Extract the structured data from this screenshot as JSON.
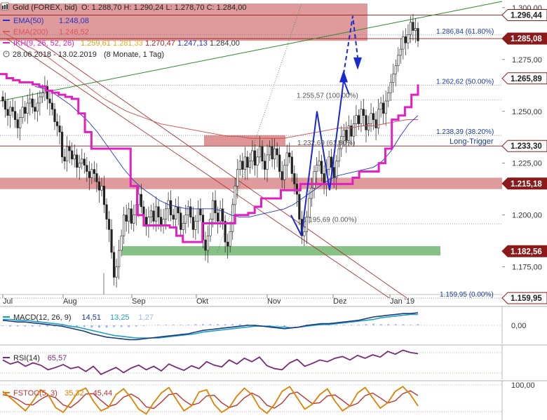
{
  "header": {
    "instrument": "Gold (FOREX, bid)",
    "ohlc": "O: 1.288,70  H: 1.290,24  L: 1.278,70  C: 1.284,00",
    "legend": [
      {
        "label": "EMA(50)",
        "value": "1.248,08",
        "color": "#2233cc"
      },
      {
        "label": "EMA(200)",
        "value": "1.246,52",
        "color": "#dd5555"
      },
      {
        "label": "IKH(9, 26, 52, 26)",
        "value": "",
        "color": "#e020c0"
      }
    ],
    "ikh_values": [
      {
        "v": "1.259,61",
        "color": "#d4a017"
      },
      {
        "v": "1.281,33",
        "color": "#e0b020"
      },
      {
        "v": "1.270,47",
        "color": "#aa2222"
      },
      {
        "v": "1.247,13",
        "color": "#2233cc"
      },
      {
        "v": "1.284,00",
        "color": "#333333"
      }
    ],
    "period": "28.06.2018 - 13.02.2019",
    "period_note": "(8 Monate, 1 Tag)"
  },
  "chart_data": [
    {
      "type": "candlestick",
      "ylim": [
        1160,
        1302
      ],
      "y_ticks": [
        "1.300,00",
        "1.275,00",
        "1.250,00",
        "1.225,00",
        "1.200,00",
        "1.175,00"
      ],
      "y_tick_values": [
        1300,
        1275,
        1250,
        1225,
        1200,
        1175
      ],
      "x_ticks": [
        "Jul",
        "Aug",
        "Sep",
        "Okt",
        "Nov",
        "Dez",
        "Jan '19"
      ],
      "price_tags": [
        {
          "label": "1.296,44",
          "value": 1296.44,
          "style": "line"
        },
        {
          "label": "1.285,08",
          "value": 1285.08,
          "style": "fill"
        },
        {
          "label": "1.265,89",
          "value": 1265.89,
          "style": "line"
        },
        {
          "label": "1.233,30",
          "value": 1233.3,
          "style": "line"
        },
        {
          "label": "1.215,18",
          "value": 1215.18,
          "style": "fill"
        },
        {
          "label": "1.182,56",
          "value": 1182.56,
          "style": "fill"
        },
        {
          "label": "1.159,95",
          "value": 1159.95,
          "style": "line"
        }
      ],
      "fibonacci": [
        {
          "label": "1.286,84 (61.80%)",
          "value": 1286.84
        },
        {
          "label": "1.262,62 (50.00%)",
          "value": 1262.62
        },
        {
          "label": "1.238,39 (38.20%)",
          "value": 1238.39
        },
        {
          "label": "1.159,95 (0.00%)",
          "value": 1159.95
        }
      ],
      "annotations": [
        {
          "label": "Long-Trigger",
          "value": 1233.3
        },
        {
          "label": "1.255,57 (100.00%)",
          "value": 1255.57
        },
        {
          "label": "1.232,69 (61.80%)",
          "value": 1232.69
        },
        {
          "label": "1.195,69 (0.00%)",
          "value": 1195.69
        }
      ],
      "closes": [
        1255,
        1251,
        1248,
        1252,
        1250,
        1246,
        1242,
        1247,
        1252,
        1249,
        1254,
        1256,
        1252,
        1250,
        1254,
        1257,
        1259,
        1262,
        1256,
        1254,
        1251,
        1245,
        1243,
        1240,
        1228,
        1226,
        1233,
        1231,
        1227,
        1229,
        1223,
        1225,
        1227,
        1224,
        1221,
        1218,
        1222,
        1220,
        1216,
        1212,
        1214,
        1205,
        1198,
        1193,
        1182,
        1170,
        1175,
        1183,
        1190,
        1200,
        1197,
        1203,
        1196,
        1200,
        1205,
        1210,
        1204,
        1199,
        1195,
        1199,
        1202,
        1197,
        1204,
        1199,
        1195,
        1198,
        1203,
        1207,
        1200,
        1198,
        1204,
        1201,
        1193,
        1196,
        1200,
        1204,
        1199,
        1193,
        1197,
        1203,
        1200,
        1188,
        1183,
        1190,
        1198,
        1207,
        1201,
        1197,
        1203,
        1197,
        1187,
        1185,
        1192,
        1205,
        1214,
        1222,
        1226,
        1222,
        1228,
        1223,
        1226,
        1231,
        1224,
        1228,
        1233,
        1226,
        1222,
        1229,
        1233,
        1227,
        1232,
        1229,
        1221,
        1217,
        1224,
        1230,
        1228,
        1220,
        1215,
        1210,
        1198,
        1190,
        1192,
        1199,
        1208,
        1213,
        1221,
        1224,
        1226,
        1220,
        1215,
        1222,
        1228,
        1223,
        1218,
        1226,
        1232,
        1238,
        1241,
        1236,
        1243,
        1238,
        1244,
        1248,
        1244,
        1251,
        1248,
        1241,
        1244,
        1249,
        1246,
        1242,
        1251,
        1254,
        1249,
        1255,
        1259,
        1264,
        1268,
        1272,
        1277,
        1280,
        1286,
        1283,
        1287,
        1293,
        1289,
        1290,
        1284
      ],
      "ema50": [
        1262,
        1261,
        1259,
        1256,
        1253,
        1249,
        1245,
        1240,
        1234,
        1228,
        1222,
        1217,
        1213,
        1210,
        1207,
        1205,
        1204,
        1203,
        1203,
        1203,
        1203,
        1202,
        1200,
        1199,
        1199,
        1200,
        1201,
        1202,
        1203,
        1205,
        1208,
        1211,
        1214,
        1217,
        1219,
        1220,
        1221,
        1222,
        1223,
        1226,
        1231,
        1238,
        1244,
        1248
      ],
      "ema200": [
        1288,
        1285,
        1282,
        1279,
        1276,
        1272,
        1268,
        1264,
        1260,
        1256,
        1253,
        1250,
        1248,
        1246,
        1244,
        1243,
        1242,
        1241,
        1240,
        1239,
        1238,
        1238,
        1237,
        1237,
        1237,
        1237,
        1238,
        1239,
        1240,
        1241,
        1242,
        1242,
        1243,
        1243,
        1244,
        1245,
        1246,
        1246
      ],
      "ikh": [
        1268,
        1266,
        1265,
        1264,
        1264,
        1263,
        1262,
        1260,
        1259,
        1258,
        1257,
        1256,
        1249,
        1240,
        1232,
        1232,
        1232,
        1232,
        1232,
        1232,
        1214,
        1200,
        1195,
        1195,
        1195,
        1195,
        1194,
        1190,
        1187,
        1187,
        1187,
        1196,
        1196,
        1196,
        1196,
        1196,
        1200,
        1200,
        1201,
        1204,
        1208,
        1208,
        1208,
        1212,
        1212,
        1212,
        1215,
        1215,
        1215,
        1215,
        1215,
        1215,
        1215,
        1215,
        1218,
        1221,
        1221,
        1221,
        1225,
        1232,
        1246,
        1248,
        1252,
        1258,
        1263
      ],
      "forecast": {
        "path_label": "",
        "points": []
      }
    },
    {
      "type": "line",
      "name": "MACD(12, 26, 9)",
      "values_text": [
        "14,51",
        "13,25",
        "1,27"
      ],
      "value_colors": [
        "#1a3a80",
        "#20a0c0",
        "#9fb8e8"
      ],
      "y_ticks": [
        "0,00"
      ],
      "macd": [
        6,
        5,
        4,
        4,
        3,
        2,
        1,
        0,
        -1,
        -3,
        -5,
        -7,
        -10,
        -12,
        -14,
        -15,
        -16,
        -17,
        -17,
        -16,
        -15,
        -14,
        -13,
        -12,
        -11,
        -10,
        -8,
        -6,
        -5,
        -4,
        -3,
        -2,
        -1,
        0,
        0,
        -1,
        -2,
        -3,
        -4,
        -3,
        -2,
        0,
        1,
        2,
        2,
        3,
        4,
        5,
        6,
        8,
        10,
        11,
        12,
        13,
        14,
        14,
        15
      ],
      "signal": [
        7,
        7,
        6,
        6,
        5,
        4,
        3,
        2,
        1,
        -1,
        -2,
        -4,
        -6,
        -8,
        -10,
        -12,
        -13,
        -14,
        -15,
        -15,
        -15,
        -15,
        -14,
        -13,
        -12,
        -11,
        -10,
        -8,
        -7,
        -6,
        -5,
        -4,
        -3,
        -2,
        -1,
        -1,
        -1,
        -2,
        -2,
        -3,
        -2,
        -1,
        0,
        1,
        1,
        2,
        3,
        4,
        5,
        6,
        7,
        9,
        10,
        11,
        12,
        13,
        13
      ]
    },
    {
      "type": "line",
      "name": "RSI(14)",
      "values_text": [
        "65,57"
      ],
      "value_colors": [
        "#7a2a7a"
      ],
      "values": [
        55,
        48,
        52,
        44,
        50,
        46,
        38,
        42,
        47,
        40,
        43,
        35,
        44,
        30,
        36,
        42,
        33,
        41,
        46,
        38,
        44,
        36,
        48,
        42,
        37,
        45,
        40,
        52,
        46,
        43,
        55,
        48,
        58,
        52,
        60,
        45,
        40,
        38,
        50,
        56,
        44,
        49,
        55,
        52,
        58,
        61,
        55,
        63,
        58,
        64,
        60,
        70,
        65,
        72,
        68,
        66
      ]
    },
    {
      "type": "line",
      "name": "FSTOC(5, 3)",
      "values_text": [
        "35,32",
        "45,44"
      ],
      "value_colors": [
        "#e08000",
        "#bb3333"
      ],
      "y_ticks": [
        "100,00"
      ],
      "k": [
        80,
        60,
        40,
        20,
        50,
        85,
        70,
        30,
        15,
        45,
        80,
        90,
        50,
        20,
        30,
        70,
        88,
        60,
        25,
        10,
        45,
        75,
        92,
        55,
        20,
        35,
        78,
        85,
        40,
        15,
        30,
        65,
        90,
        70,
        30,
        12,
        40,
        80,
        95,
        60,
        25,
        40,
        70,
        88,
        50,
        20,
        35,
        75,
        92,
        60,
        28,
        45,
        80,
        95,
        70,
        35
      ],
      "d": [
        70,
        65,
        55,
        40,
        38,
        55,
        68,
        60,
        38,
        30,
        48,
        72,
        73,
        52,
        33,
        40,
        62,
        72,
        58,
        32,
        27,
        47,
        70,
        74,
        52,
        37,
        44,
        66,
        68,
        45,
        30,
        37,
        60,
        75,
        63,
        37,
        28,
        44,
        72,
        78,
        60,
        42,
        45,
        66,
        69,
        52,
        34,
        43,
        67,
        75,
        60,
        44,
        51,
        73,
        82,
        67
      ]
    }
  ]
}
